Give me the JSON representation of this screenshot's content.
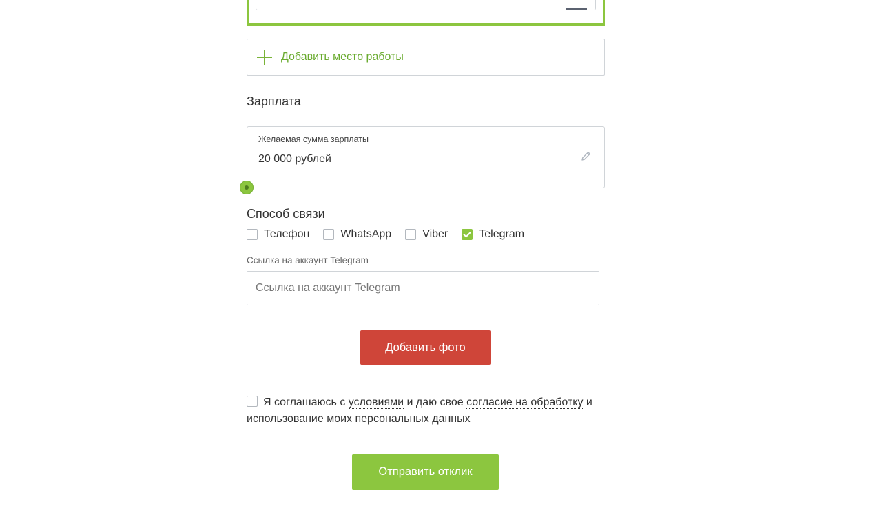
{
  "work": {
    "add_label": "Добавить место работы"
  },
  "salary": {
    "section_title": "Зарплата",
    "field_label": "Желаемая сумма зарплаты",
    "value": "20 000 рублей"
  },
  "contact": {
    "section_title": "Способ связи",
    "options": [
      {
        "label": "Телефон",
        "checked": false
      },
      {
        "label": "WhatsApp",
        "checked": false
      },
      {
        "label": "Viber",
        "checked": false
      },
      {
        "label": "Telegram",
        "checked": true
      }
    ],
    "telegram_caption": "Ссылка на аккаунт Telegram",
    "telegram_placeholder": "Ссылка на аккаунт Telegram"
  },
  "photo_button": "Добавить фото",
  "agreement": {
    "checked": false,
    "text_1": "Я соглашаюсь с ",
    "link_terms": "условиями",
    "text_2": " и даю свое ",
    "link_consent": "согласие на обработку",
    "text_3": " и использование моих персональных данных"
  },
  "submit_button": "Отправить отклик",
  "colors": {
    "accent_green": "#8cc63f",
    "accent_red": "#cf4539"
  }
}
